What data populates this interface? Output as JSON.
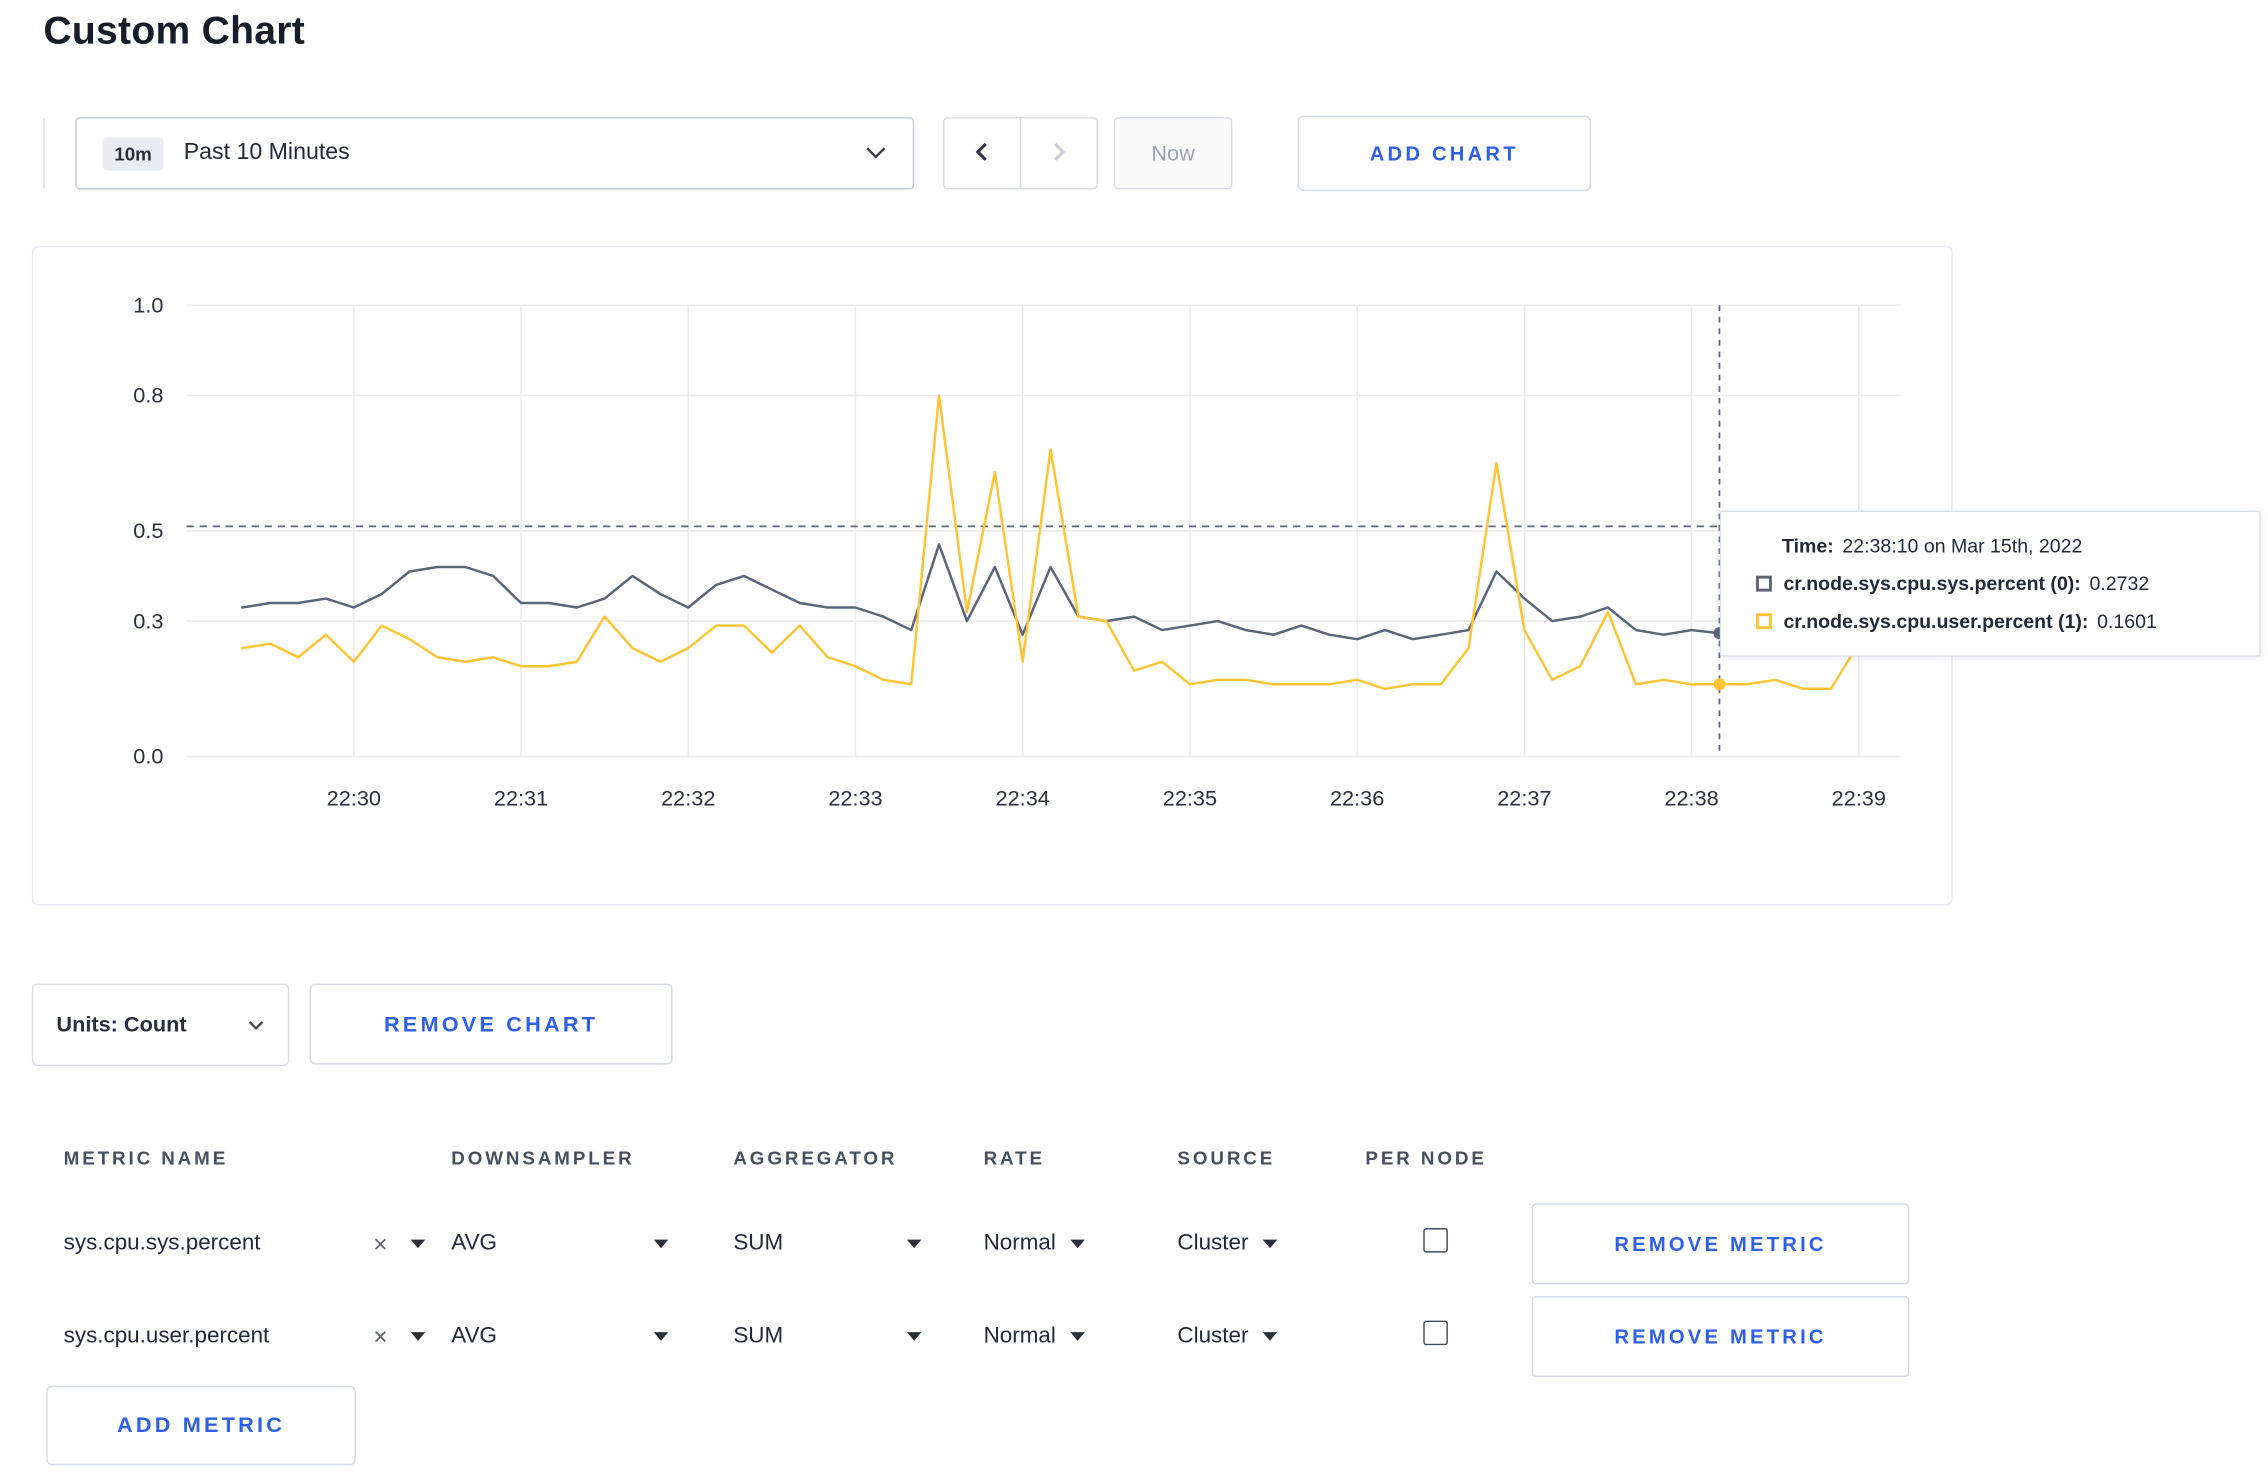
{
  "colors": {
    "accent": "#2e5fe8",
    "grid": "#ebebeb",
    "crosshair": "#5c6372"
  },
  "page": {
    "title": "Custom Chart"
  },
  "toolbar": {
    "range_badge": "10m",
    "range_label": "Past 10 Minutes",
    "now_label": "Now",
    "add_chart_label": "ADD CHART"
  },
  "chart_controls": {
    "units_label": "Units: Count",
    "remove_chart_label": "REMOVE CHART",
    "add_metric_label": "ADD METRIC"
  },
  "tooltip": {
    "time_label": "Time:",
    "time_value": "22:38:10 on Mar 15th, 2022",
    "series": [
      {
        "label": "cr.node.sys.cpu.sys.percent (0):",
        "value": "0.2732",
        "color": "#5b6479"
      },
      {
        "label": "cr.node.sys.cpu.user.percent (1):",
        "value": "0.1601",
        "color": "#ffc333"
      }
    ]
  },
  "metrics_table": {
    "headers": [
      "METRIC NAME",
      "DOWNSAMPLER",
      "AGGREGATOR",
      "RATE",
      "SOURCE",
      "PER NODE"
    ],
    "clear_icon": "×",
    "rows": [
      {
        "metric": "sys.cpu.sys.percent",
        "downsampler": "AVG",
        "aggregator": "SUM",
        "rate": "Normal",
        "source": "Cluster",
        "per_node_checked": false,
        "remove_label": "REMOVE METRIC"
      },
      {
        "metric": "sys.cpu.user.percent",
        "downsampler": "AVG",
        "aggregator": "SUM",
        "rate": "Normal",
        "source": "Cluster",
        "per_node_checked": false,
        "remove_label": "REMOVE METRIC"
      }
    ]
  },
  "chart_data": {
    "type": "line",
    "title": "",
    "xlabel": "",
    "ylabel": "",
    "ylim": [
      0,
      1.0
    ],
    "grid": true,
    "y_tick_labels": [
      "0.0",
      "0.3",
      "0.5",
      "0.8",
      "1.0"
    ],
    "x_tick_labels": [
      "22:30",
      "22:31",
      "22:32",
      "22:33",
      "22:34",
      "22:35",
      "22:36",
      "22:37",
      "22:38",
      "22:39"
    ],
    "x_start": "22:29:20",
    "x_step_seconds": 10,
    "threshold_y": 0.51,
    "hover": {
      "time": "22:38:10",
      "index": 53,
      "values": [
        0.2732,
        0.1601
      ]
    },
    "series": [
      {
        "name": "cr.node.sys.cpu.sys.percent",
        "color": "#5b6479",
        "values": [
          0.33,
          0.34,
          0.34,
          0.35,
          0.33,
          0.36,
          0.41,
          0.42,
          0.42,
          0.4,
          0.34,
          0.34,
          0.33,
          0.35,
          0.4,
          0.36,
          0.33,
          0.38,
          0.4,
          0.37,
          0.34,
          0.33,
          0.33,
          0.31,
          0.28,
          0.47,
          0.3,
          0.42,
          0.27,
          0.42,
          0.31,
          0.3,
          0.31,
          0.28,
          0.29,
          0.3,
          0.28,
          0.27,
          0.29,
          0.27,
          0.26,
          0.28,
          0.26,
          0.27,
          0.28,
          0.41,
          0.35,
          0.3,
          0.31,
          0.33,
          0.28,
          0.27,
          0.28,
          0.2732,
          0.31,
          0.32,
          0.3,
          0.3,
          0.31,
          0.3
        ]
      },
      {
        "name": "cr.node.sys.cpu.user.percent",
        "color": "#ffc333",
        "values": [
          0.24,
          0.25,
          0.22,
          0.27,
          0.21,
          0.29,
          0.26,
          0.22,
          0.21,
          0.22,
          0.2,
          0.2,
          0.21,
          0.31,
          0.24,
          0.21,
          0.24,
          0.29,
          0.29,
          0.23,
          0.29,
          0.22,
          0.2,
          0.17,
          0.16,
          0.8,
          0.32,
          0.63,
          0.21,
          0.68,
          0.31,
          0.3,
          0.19,
          0.21,
          0.16,
          0.17,
          0.17,
          0.16,
          0.16,
          0.16,
          0.17,
          0.15,
          0.16,
          0.16,
          0.24,
          0.65,
          0.28,
          0.17,
          0.2,
          0.32,
          0.16,
          0.17,
          0.16,
          0.1601,
          0.16,
          0.17,
          0.15,
          0.15,
          0.25,
          0.27
        ]
      }
    ]
  }
}
